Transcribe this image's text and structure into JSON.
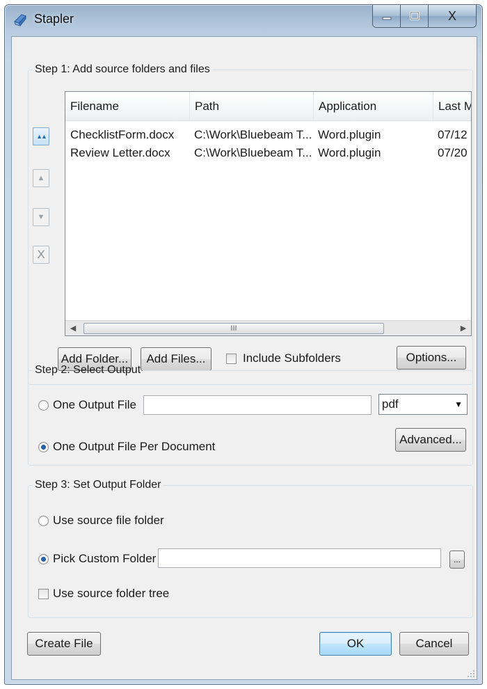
{
  "window": {
    "title": "Stapler",
    "controls": {
      "minimize": "–",
      "maximize": "□",
      "close": "X"
    }
  },
  "step1": {
    "legend": "Step 1: Add source folders and files",
    "columns": [
      "Filename",
      "Path",
      "Application",
      "Last M"
    ],
    "rows": [
      {
        "filename": "ChecklistForm.docx",
        "path": "C:\\Work\\Bluebeam T...",
        "application": "Word.plugin",
        "last_modified": "07/12"
      },
      {
        "filename": "Review Letter.docx",
        "path": "C:\\Work\\Bluebeam T...",
        "application": "Word.plugin",
        "last_modified": "07/20"
      }
    ],
    "side_buttons": {
      "top": "▲▲",
      "up": "▲",
      "down": "▼",
      "remove": "X"
    },
    "scroll_thumb": "III",
    "add_folder": "Add Folder...",
    "add_files": "Add Files...",
    "include_subfolders": "Include Subfolders",
    "include_subfolders_checked": false,
    "options": "Options..."
  },
  "step2": {
    "legend": "Step 2: Select Output",
    "one_output_file": "One Output File",
    "one_output_file_checked": false,
    "output_file_value": "",
    "format_value": "pdf",
    "one_per_document": "One Output File Per Document",
    "one_per_document_checked": true,
    "advanced": "Advanced..."
  },
  "step3": {
    "legend": "Step 3: Set Output Folder",
    "use_source_folder": "Use source file folder",
    "use_source_folder_checked": false,
    "pick_custom": "Pick Custom Folder",
    "pick_custom_checked": true,
    "custom_folder_value": "",
    "browse": "...",
    "use_source_tree": "Use source folder tree",
    "use_source_tree_checked": false
  },
  "footer": {
    "create_file": "Create File",
    "ok": "OK",
    "cancel": "Cancel"
  },
  "colors": {
    "title_bar": "#c6d7e8",
    "client": "#f0f0f0",
    "default_button": "#bee6fd",
    "radio_dot": "#1d4e8f"
  }
}
